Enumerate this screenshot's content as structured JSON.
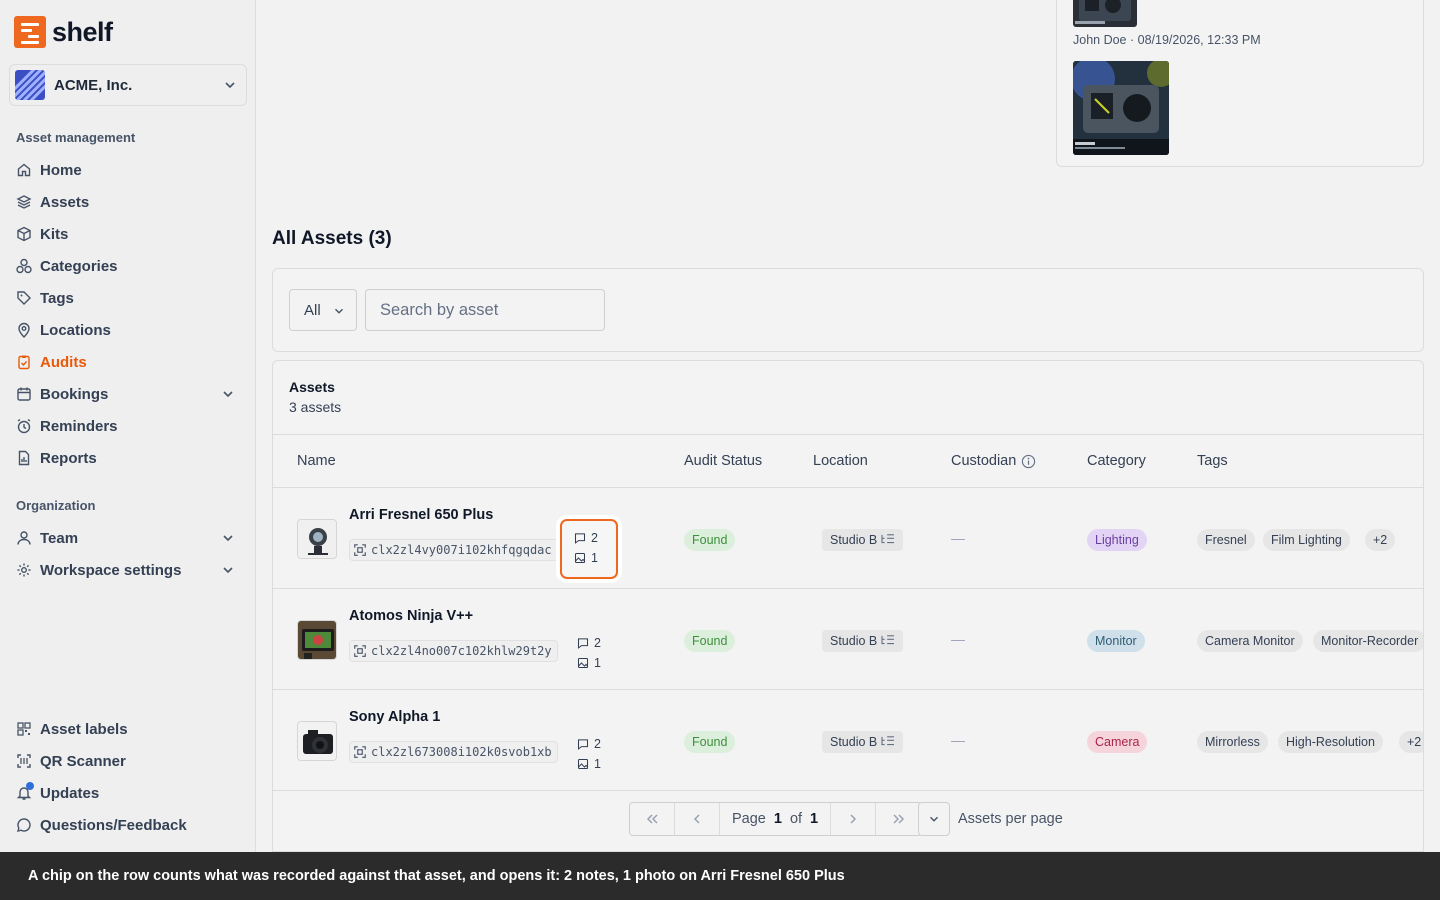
{
  "brand": {
    "name": "shelf",
    "accent": "#ef6820"
  },
  "workspace": {
    "name": "ACME, Inc."
  },
  "sidebar": {
    "section1": "Asset management",
    "items": [
      {
        "label": "Home",
        "icon": "home-icon"
      },
      {
        "label": "Assets",
        "icon": "layers-icon"
      },
      {
        "label": "Kits",
        "icon": "box-icon"
      },
      {
        "label": "Categories",
        "icon": "shapes-icon"
      },
      {
        "label": "Tags",
        "icon": "tag-icon"
      },
      {
        "label": "Locations",
        "icon": "pin-icon"
      },
      {
        "label": "Audits",
        "icon": "clipboard-icon",
        "active": true
      },
      {
        "label": "Bookings",
        "icon": "calendar-icon"
      },
      {
        "label": "Reminders",
        "icon": "alarm-icon"
      },
      {
        "label": "Reports",
        "icon": "report-icon"
      }
    ],
    "section2": "Organization",
    "org_items": [
      {
        "label": "Team",
        "icon": "user-icon"
      },
      {
        "label": "Workspace settings",
        "icon": "gear-icon"
      }
    ],
    "bottom_items": [
      {
        "label": "Asset labels",
        "icon": "qr-icon"
      },
      {
        "label": "QR Scanner",
        "icon": "scan-icon"
      },
      {
        "label": "Updates",
        "icon": "bell-icon"
      },
      {
        "label": "Questions/Feedback",
        "icon": "chat-icon"
      }
    ]
  },
  "activity": {
    "meta": "John Doe · 08/19/2026, 12:33 PM"
  },
  "page": {
    "title": "All Assets (3)"
  },
  "filters": {
    "status": "All",
    "search_placeholder": "Search by asset"
  },
  "table": {
    "title": "Assets",
    "subtitle": "3 assets",
    "headers": {
      "name": "Name",
      "audit_status": "Audit Status",
      "location": "Location",
      "custodian": "Custodian",
      "category": "Category",
      "tags": "Tags"
    },
    "rows": [
      {
        "name": "Arri Fresnel 650 Plus",
        "id": "clx2zl4vy007i102khfqgqdac",
        "notes": "2",
        "photos": "1",
        "status": "Found",
        "location": "Studio B",
        "custodian": "—",
        "category": "Lighting",
        "category_color": "#e3d4f5",
        "category_text": "#6b3fa0",
        "tags": [
          "Fresnel",
          "Film Lighting"
        ],
        "more": "+2"
      },
      {
        "name": "Atomos Ninja V++",
        "id": "clx2zl4no007c102khlw29t2y",
        "notes": "2",
        "photos": "1",
        "status": "Found",
        "location": "Studio B",
        "custodian": "—",
        "category": "Monitor",
        "category_color": "#cfe0ea",
        "category_text": "#2f5d75",
        "tags": [
          "Camera Monitor",
          "Monitor-Recorder"
        ],
        "more": ""
      },
      {
        "name": "Sony Alpha 1",
        "id": "clx2zl673008i102k0svob1xb",
        "notes": "2",
        "photos": "1",
        "status": "Found",
        "location": "Studio B",
        "custodian": "—",
        "category": "Camera",
        "category_color": "#f6d4dc",
        "category_text": "#a8244a",
        "tags": [
          "Mirrorless",
          "High-Resolution"
        ],
        "more": "+2"
      }
    ]
  },
  "pagination": {
    "page_label": "Page",
    "current": "1",
    "of_label": "of",
    "total": "1",
    "per_page_label": "Assets per page"
  },
  "caption": "A chip on the row counts what was recorded against that asset, and opens it: 2 notes, 1 photo on Arri Fresnel 650 Plus"
}
